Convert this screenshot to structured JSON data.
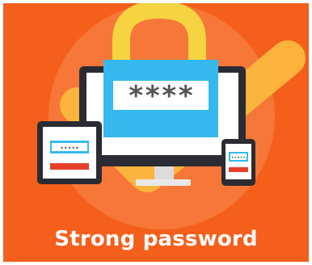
{
  "illustration": {
    "title": "Strong password",
    "monitor_mask": "****",
    "tablet_mask": "•••••",
    "phone_mask": "•••••",
    "icons": [
      "padlock-icon",
      "checkmark-icon",
      "monitor-icon",
      "tablet-icon",
      "phone-icon"
    ],
    "colors": {
      "background": "#f45f1c",
      "glow": "#f78a4e",
      "checkmark": "#fbb73d",
      "shackle": "#f6d341",
      "lock_body": "#35b8ee",
      "device_frame": "#2b2c33",
      "screen": "#ffffff",
      "field": "#ffffff",
      "mask_text": "#555555",
      "alert_bar": "#e5402a",
      "title_text": "#ffffff"
    }
  }
}
